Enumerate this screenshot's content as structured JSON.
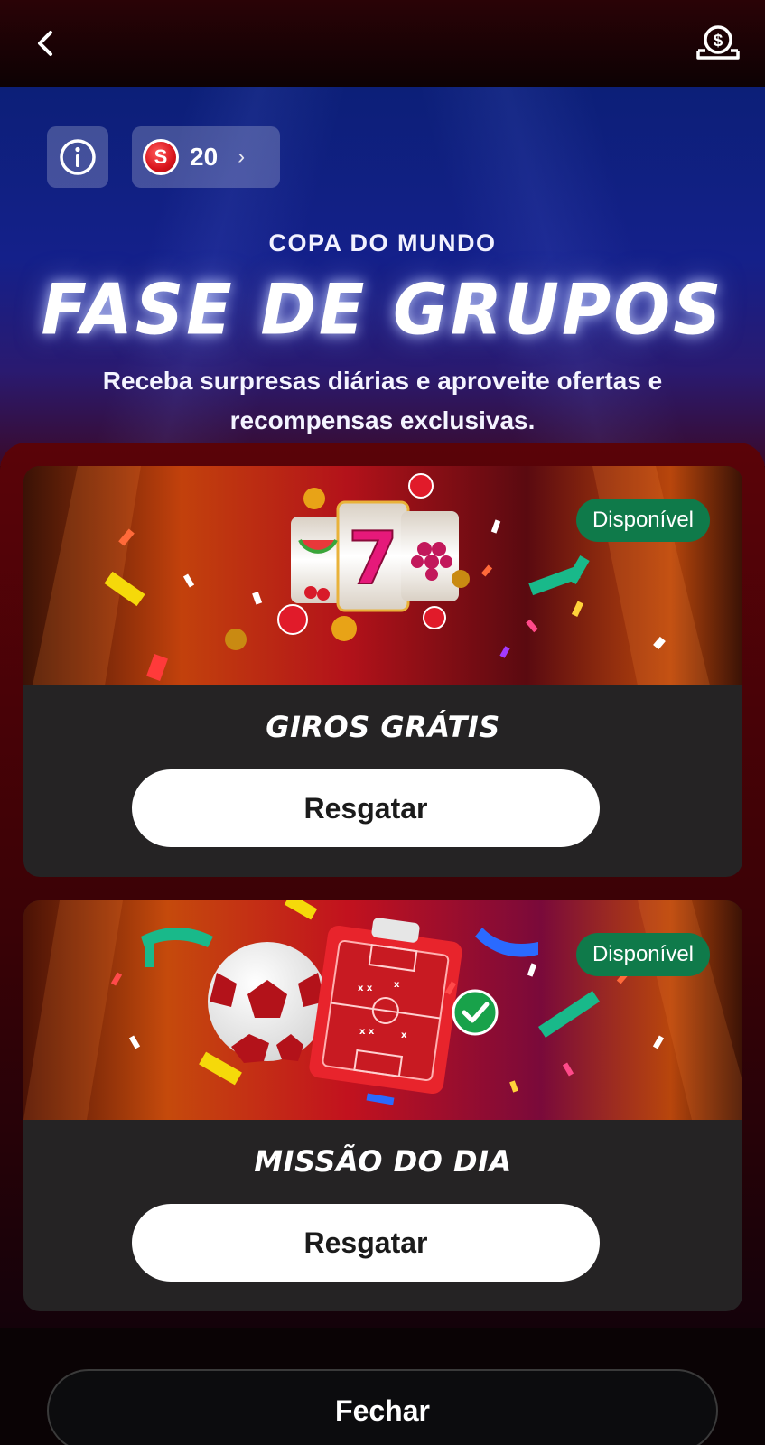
{
  "icons": {
    "back": "chevron-left-icon",
    "cashier": "cashier-coin-icon",
    "info": "info-circle-icon",
    "coin": "coin-s-icon",
    "chevron": "chevron-right-icon"
  },
  "header": {
    "coin_symbol": "S",
    "coins": "20",
    "chevron": "›"
  },
  "hero": {
    "eyebrow": "COPA DO MUNDO",
    "title": "FASE DE GRUPOS",
    "subtitle": "Receba surpresas diárias e aproveite ofertas e recompensas exclusivas."
  },
  "cards": [
    {
      "status": "Disponível",
      "title": "GIROS GRÁTIS",
      "button": "Resgatar",
      "image_number": "7"
    },
    {
      "status": "Disponível",
      "title": "MISSÃO DO DIA",
      "button": "Resgatar"
    }
  ],
  "footer": {
    "close_label": "Fechar"
  },
  "colors": {
    "status_badge": "#0f7a4a",
    "hero_blue": "#14208a",
    "panel_red": "#5a0308",
    "accent_red": "#d8141c"
  }
}
